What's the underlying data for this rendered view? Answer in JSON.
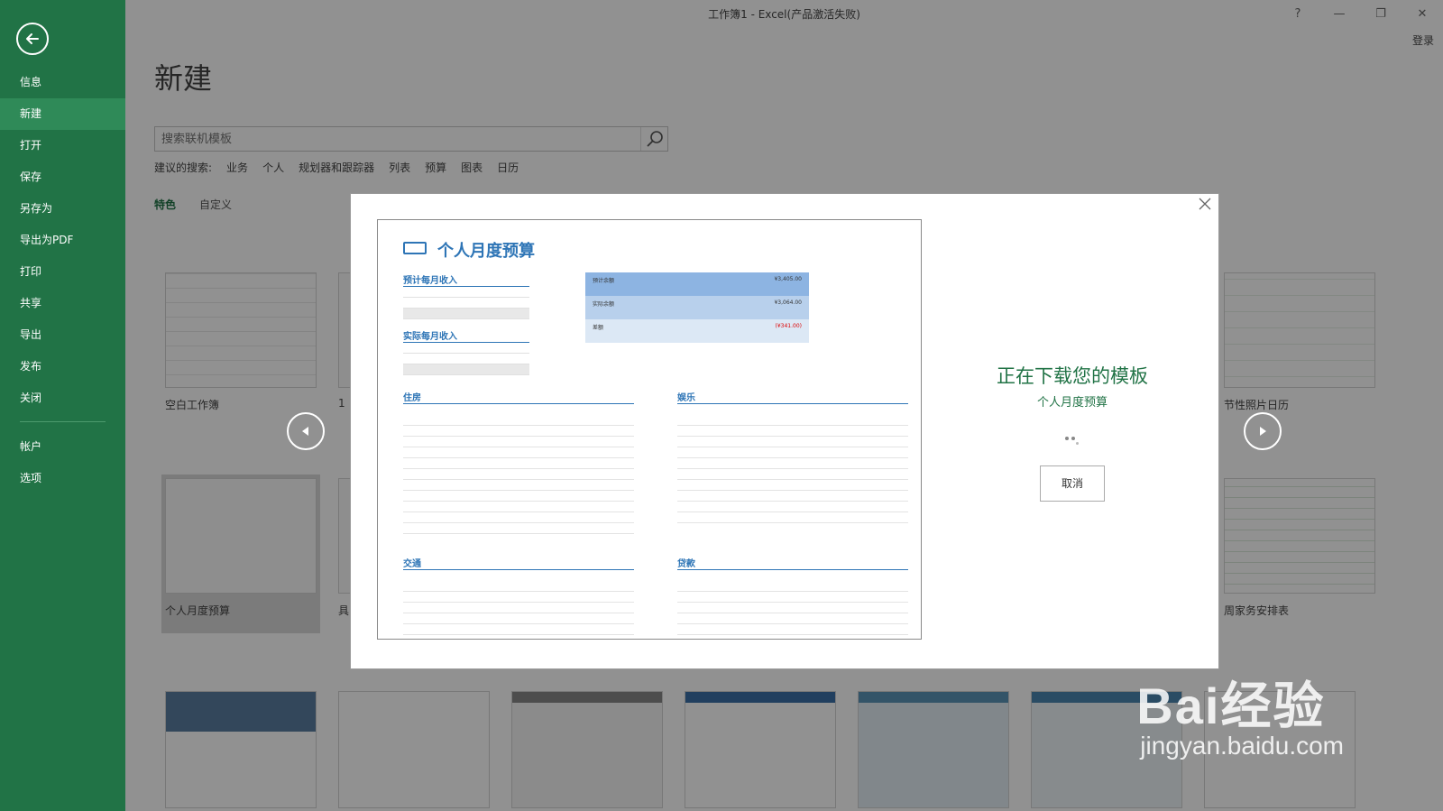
{
  "window": {
    "title": "工作簿1 - Excel(产品激活失败)",
    "help": "?",
    "minimize": "—",
    "restore": "❐",
    "close": "✕",
    "login": "登录"
  },
  "sidebar": {
    "items": [
      {
        "label": "信息"
      },
      {
        "label": "新建",
        "active": true
      },
      {
        "label": "打开"
      },
      {
        "label": "保存"
      },
      {
        "label": "另存为"
      },
      {
        "label": "导出为PDF"
      },
      {
        "label": "打印"
      },
      {
        "label": "共享"
      },
      {
        "label": "导出"
      },
      {
        "label": "发布"
      },
      {
        "label": "关闭"
      }
    ],
    "bottom_items": [
      {
        "label": "帐户"
      },
      {
        "label": "选项"
      }
    ]
  },
  "main": {
    "page_title": "新建",
    "search_placeholder": "搜索联机模板",
    "suggested_label": "建议的搜索:",
    "suggested": [
      "业务",
      "个人",
      "规划器和跟踪器",
      "列表",
      "预算",
      "图表",
      "日历"
    ],
    "tabs": [
      "特色",
      "自定义"
    ],
    "templates": [
      {
        "label": "空白工作簿"
      },
      {
        "label": "1"
      },
      {
        "label": "节性照片日历"
      },
      {
        "label": "个人月度预算"
      },
      {
        "label": "具"
      },
      {
        "label": "周家务安排表"
      }
    ]
  },
  "modal": {
    "status_title": "正在下载您的模板",
    "status_subtitle": "个人月度预算",
    "cancel_label": "取消",
    "preview": {
      "title": "个人月度预算",
      "income_planned": "预计每月收入",
      "income_actual": "实际每月收入",
      "housing": "住房",
      "entertainment": "娱乐",
      "transport": "交通",
      "loans": "贷款",
      "summary": [
        {
          "label": "预计余额",
          "value": "¥3,405.00"
        },
        {
          "label": "实际余额",
          "value": "¥3,064.00"
        },
        {
          "label": "差额",
          "value": "(¥341.00)"
        }
      ]
    }
  },
  "watermark": {
    "logo": "Bai经验",
    "url": "jingyan.baidu.com"
  },
  "colors": {
    "brand": "#217346",
    "accent_blue": "#2e75b6"
  }
}
